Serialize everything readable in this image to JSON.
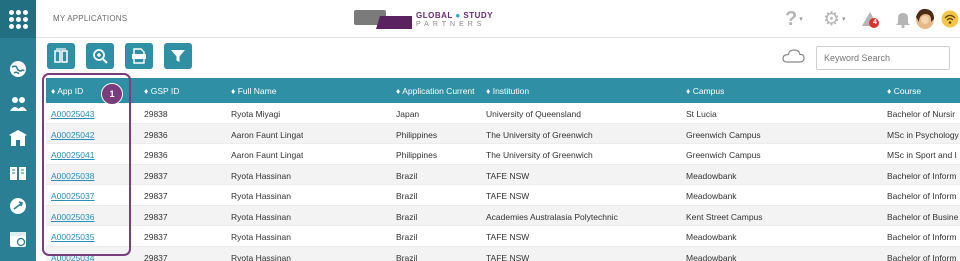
{
  "header": {
    "app_title": "MY APPLICATIONS",
    "brand_line1_a": "GLOBAL",
    "brand_line1_b": "STUDY",
    "brand_line2": "PARTNERS",
    "notification_count": "4"
  },
  "toolbar": {
    "search_placeholder": "Keyword Search"
  },
  "table": {
    "columns": [
      "App ID",
      "GSP ID",
      "Full Name",
      "Application Current",
      "Institution",
      "Campus",
      "Course"
    ],
    "rows": [
      [
        "A00025043",
        "29838",
        "Ryota Miyagi",
        "Japan",
        "University of Queensland",
        "St Lucia",
        "Bachelor of Nursir"
      ],
      [
        "A00025042",
        "29836",
        "Aaron Faunt Lingat",
        "Philippines",
        "The University of Greenwich",
        "Greenwich Campus",
        "MSc in Psychology"
      ],
      [
        "A00025041",
        "29836",
        "Aaron Faunt Lingat",
        "Philippines",
        "The University of Greenwich",
        "Greenwich Campus",
        "MSc in Sport and I"
      ],
      [
        "A00025038",
        "29837",
        "Ryota Hassinan",
        "Brazil",
        "TAFE NSW",
        "Meadowbank",
        "Bachelor of Inform"
      ],
      [
        "A00025037",
        "29837",
        "Ryota Hassinan",
        "Brazil",
        "TAFE NSW",
        "Meadowbank",
        "Bachelor of Inform"
      ],
      [
        "A00025036",
        "29837",
        "Ryota Hassinan",
        "Brazil",
        "Academies Australasia Polytechnic",
        "Kent Street Campus",
        "Bachelor of Busine"
      ],
      [
        "A00025035",
        "29837",
        "Ryota Hassinan",
        "Brazil",
        "TAFE NSW",
        "Meadowbank",
        "Bachelor of Inform"
      ],
      [
        "A00025034",
        "29837",
        "Ryota Hassinan",
        "Brazil",
        "TAFE NSW",
        "Meadowbank",
        "Bachelor of Inform"
      ]
    ]
  },
  "annotation": {
    "badge_label": "1"
  },
  "colors": {
    "accent": "#2e8fa5",
    "rail": "#2b7f94",
    "link": "#2a8fb8",
    "highlight": "#7a3c7c"
  }
}
